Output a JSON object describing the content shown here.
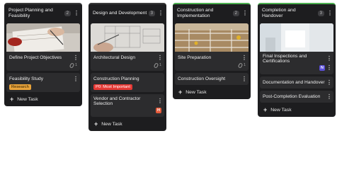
{
  "columns": [
    {
      "title": "Project Planning and Feasibility",
      "count": "2",
      "cards": [
        {
          "title": "Define Project Objectives",
          "image": "planning-photo",
          "attachments": "1"
        },
        {
          "title": "Feasibility Study",
          "tag": "Research"
        }
      ],
      "new_task": "New Task"
    },
    {
      "title": "Design and Development",
      "count": "3",
      "cards": [
        {
          "title": "Architectural Design",
          "image": "blueprint-photo",
          "attachments": "1"
        },
        {
          "title": "Construction Planning",
          "tag": "P0: Most Important"
        },
        {
          "title": "Vendor and Contractor Selection",
          "avatar": "H"
        }
      ],
      "new_task": "New Task"
    },
    {
      "title": "Construction and Implementation",
      "count": "2",
      "cards": [
        {
          "title": "Site Preparation",
          "image": "construction-site-photo",
          "attachments": "1"
        },
        {
          "title": "Construction Oversight"
        }
      ],
      "new_task": "New Task"
    },
    {
      "title": "Completion and Handover",
      "count": "3",
      "cards": [
        {
          "title": "Final Inspections and Certifications",
          "image": "office-photo",
          "avatar": "N"
        },
        {
          "title": "Documentation and Handover"
        },
        {
          "title": "Post-Completion Evaluation"
        }
      ],
      "new_task": "New Task"
    }
  ],
  "colors": {
    "column_bg": "#1d1d1f",
    "card_bg": "#2c2c2e",
    "accent_green": "#4caf50",
    "tag_research": "#e8a33a",
    "tag_p0": "#e53935",
    "avatar_h": "#e55a3a",
    "avatar_n": "#5b4fd6"
  }
}
